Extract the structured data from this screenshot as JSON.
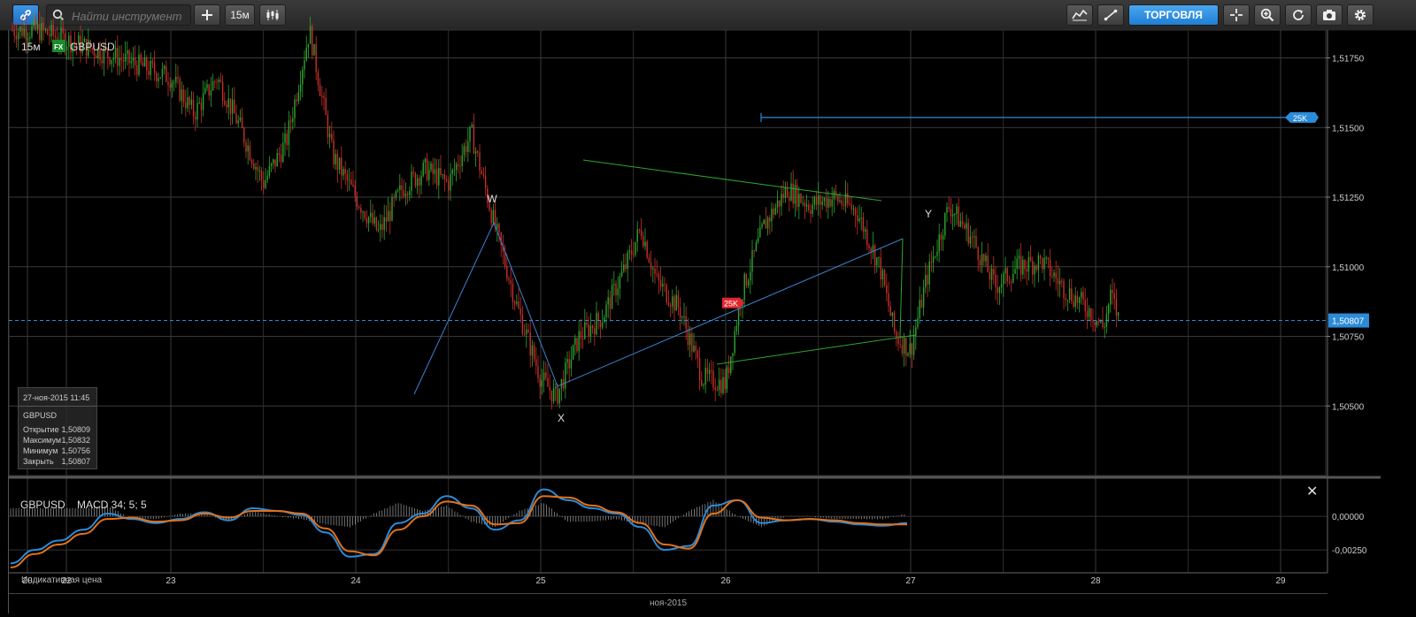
{
  "toolbar": {
    "search_placeholder": "Найти инструмент",
    "interval_label": "15м",
    "trade_label": "ТОРГОВЛЯ"
  },
  "chart_header": {
    "timeframe": "15м",
    "exchange_badge": "FX",
    "symbol": "GBPUSD"
  },
  "info_box": {
    "datetime": "27-ноя-2015 11:45",
    "symbol": "GBPUSD",
    "rows": [
      {
        "label": "Открытие",
        "value": "1,50809"
      },
      {
        "label": "Максимум",
        "value": "1,50832"
      },
      {
        "label": "Минимум",
        "value": "1,50756"
      },
      {
        "label": "Закрыть",
        "value": "1,50807"
      }
    ]
  },
  "indicator_header": {
    "symbol": "GBPUSD",
    "name": "MACD 34; 5; 5"
  },
  "indicative_price_label": "Индикативная цена",
  "x_axis_label": "ноя-2015",
  "colors": {
    "up": "#2ea52e",
    "down": "#c8302a",
    "accent": "#2c8bd8",
    "macd_line": "#2c8bd8",
    "signal_line": "#e0721c",
    "triangle": "#2ea52e",
    "wxy": "#3d82d0",
    "alert_red": "#e0262f"
  },
  "chart_data": [
    {
      "type": "candlestick",
      "symbol": "GBPUSD",
      "timeframe": "15м",
      "y_ticks": [
        "1,51750",
        "1,51500",
        "1,51250",
        "1,51000",
        "1,50750",
        "1,50500"
      ],
      "y_range": [
        1.5025,
        1.5185
      ],
      "x_ticks": [
        "20",
        "22",
        "23",
        "24",
        "25",
        "26",
        "27",
        "28",
        "29"
      ],
      "x_tick_dates": [
        "2015-11-20",
        "2015-11-22",
        "2015-11-23",
        "2015-11-24",
        "2015-11-25",
        "2015-11-26",
        "2015-11-27",
        "2015-11-28",
        "2015-11-29"
      ],
      "x_label": "ноя-2015",
      "current_price": {
        "value": 1.50807,
        "label": "1,50807"
      },
      "price_path": [
        [
          "2015-11-20 12:00",
          1.5185
        ],
        [
          "2015-11-22 12:00",
          1.5175
        ],
        [
          "2015-11-23 00:00",
          1.5168
        ],
        [
          "2015-11-23 03:00",
          1.5155
        ],
        [
          "2015-11-23 06:00",
          1.5168
        ],
        [
          "2015-11-23 09:00",
          1.515
        ],
        [
          "2015-11-23 12:00",
          1.513
        ],
        [
          "2015-11-23 15:00",
          1.5145
        ],
        [
          "2015-11-23 18:00",
          1.5185
        ],
        [
          "2015-11-23 21:00",
          1.514
        ],
        [
          "2015-11-24 00:00",
          1.5125
        ],
        [
          "2015-11-24 03:00",
          1.5112
        ],
        [
          "2015-11-24 06:00",
          1.5128
        ],
        [
          "2015-11-24 09:00",
          1.5135
        ],
        [
          "2015-11-24 12:00",
          1.513
        ],
        [
          "2015-11-24 15:00",
          1.5148
        ],
        [
          "2015-11-24 18:00",
          1.5115
        ],
        [
          "2015-11-24 21:00",
          1.5085
        ],
        [
          "2015-11-25 00:00",
          1.506
        ],
        [
          "2015-11-25 02:00",
          1.5053
        ],
        [
          "2015-11-25 05:00",
          1.5075
        ],
        [
          "2015-11-25 08:00",
          1.5082
        ],
        [
          "2015-11-25 11:00",
          1.51
        ],
        [
          "2015-11-25 13:00",
          1.5114
        ],
        [
          "2015-11-25 15:00",
          1.5095
        ],
        [
          "2015-11-25 18:00",
          1.5085
        ],
        [
          "2015-11-25 21:00",
          1.506
        ],
        [
          "2015-11-26 00:00",
          1.5058
        ],
        [
          "2015-11-26 02:00",
          1.509
        ],
        [
          "2015-11-26 05:00",
          1.5115
        ],
        [
          "2015-11-26 08:00",
          1.5128
        ],
        [
          "2015-11-26 11:00",
          1.5122
        ],
        [
          "2015-11-26 14:00",
          1.5125
        ],
        [
          "2015-11-26 17:00",
          1.512
        ],
        [
          "2015-11-26 20:00",
          1.51
        ],
        [
          "2015-11-26 22:00",
          1.5075
        ],
        [
          "2015-11-27 00:00",
          1.507
        ],
        [
          "2015-11-27 02:00",
          1.5095
        ],
        [
          "2015-11-27 05:00",
          1.5122
        ],
        [
          "2015-11-27 08:00",
          1.511
        ],
        [
          "2015-11-27 11:00",
          1.5093
        ],
        [
          "2015-11-27 14:00",
          1.51
        ],
        [
          "2015-11-27 17:00",
          1.5102
        ],
        [
          "2015-11-27 20:00",
          1.5092
        ],
        [
          "2015-11-27 23:00",
          1.5085
        ],
        [
          "2015-11-28 01:00",
          1.5078
        ],
        [
          "2015-11-28 02:00",
          1.509
        ],
        [
          "2015-11-28 03:00",
          1.5081
        ]
      ],
      "annotations": [
        {
          "text": "W",
          "value": 1.5121
        },
        {
          "text": "X",
          "value": 1.5044
        },
        {
          "text": "Y",
          "value": 1.5116
        }
      ],
      "alerts": [
        {
          "label": "25K",
          "value": 1.51536
        },
        {
          "label": "25K",
          "value": 1.5087
        }
      ]
    },
    {
      "type": "line",
      "name": "MACD 34; 5; 5",
      "y_ticks": [
        "0,00000",
        "-0,00250"
      ],
      "y_range": [
        -0.0042,
        0.0027
      ],
      "series": [
        {
          "name": "MACD",
          "values": [
            -0.0035,
            -0.0025,
            -0.0018,
            -0.001,
            0.0002,
            -0.0002,
            -0.0005,
            -0.0002,
            0.0003,
            -0.0003,
            0.0006,
            0.0004,
            0.0001,
            -0.0012,
            -0.003,
            -0.0028,
            -0.0005,
            0.0002,
            0.0015,
            0.0006,
            -0.001,
            -0.0003,
            0.002,
            0.0012,
            0.0006,
            0.0002,
            -0.0008,
            -0.0025,
            -0.0022,
            0.0008,
            0.0012,
            -0.0005,
            -0.0003,
            -0.0002,
            -0.0004,
            -0.0006,
            -0.0007,
            -0.0005
          ]
        },
        {
          "name": "Signal",
          "values": [
            -0.0038,
            -0.0028,
            -0.0021,
            -0.0013,
            -0.0002,
            -0.0001,
            -0.0004,
            -0.0003,
            0.0002,
            -0.0001,
            0.0004,
            0.0004,
            0.0002,
            -0.0009,
            -0.0026,
            -0.0029,
            -0.001,
            0.0,
            0.0011,
            0.0008,
            -0.0006,
            -0.0005,
            0.0015,
            0.0014,
            0.0008,
            0.0003,
            -0.0005,
            -0.0021,
            -0.0024,
            0.0002,
            0.0012,
            -0.0001,
            -0.0003,
            -0.0002,
            -0.0003,
            -0.0005,
            -0.0006,
            -0.0006
          ]
        }
      ]
    }
  ]
}
